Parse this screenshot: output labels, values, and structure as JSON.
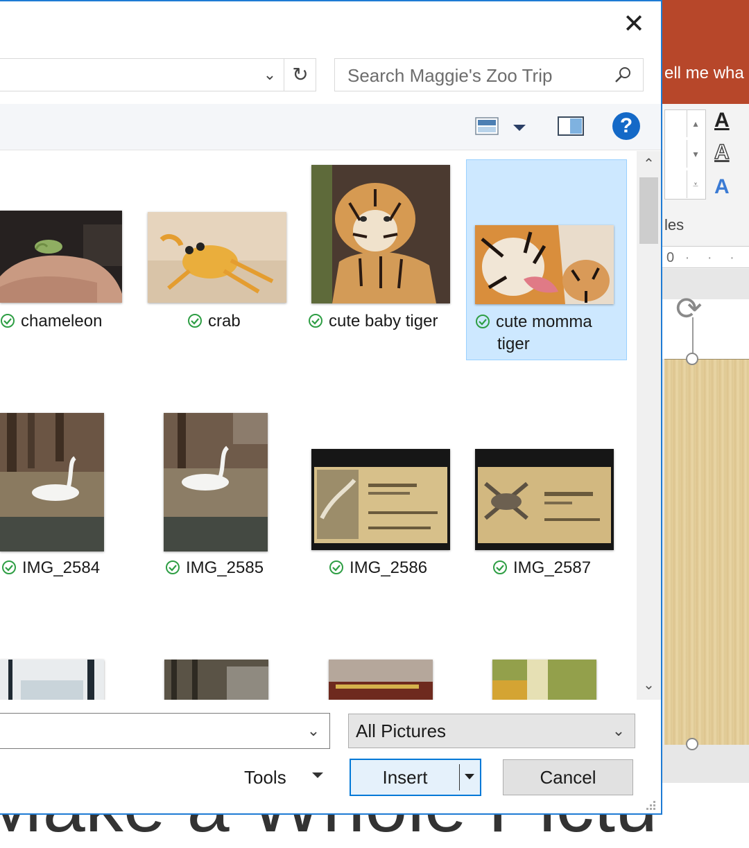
{
  "powerpoint": {
    "tell_me_text": "ell me wha",
    "styles_label": "les",
    "ruler_text": "0",
    "slide_title_text": "Make a Whole Pictu"
  },
  "dialog": {
    "close_glyph": "✕",
    "address": {
      "dropdown_glyph": "⌄",
      "refresh_glyph": "↻"
    },
    "search": {
      "placeholder": "Search Maggie's Zoo Trip"
    },
    "toolbar": {
      "help_glyph": "?"
    },
    "files": [
      {
        "label": "chameleon",
        "sync": "available",
        "selected": false
      },
      {
        "label": "crab",
        "sync": "available",
        "selected": false
      },
      {
        "label": "cute baby tiger",
        "sync": "available",
        "selected": false
      },
      {
        "label_line1": "cute momma",
        "label_line2": "tiger",
        "sync": "available",
        "selected": true
      },
      {
        "label": "IMG_2584",
        "sync": "available",
        "selected": false
      },
      {
        "label": "IMG_2585",
        "sync": "available",
        "selected": false
      },
      {
        "label": "IMG_2586",
        "sync": "available",
        "selected": false
      },
      {
        "label": "IMG_2587",
        "sync": "available",
        "selected": false
      }
    ],
    "scrollbar": {
      "up_glyph": "⌃",
      "down_glyph": "⌄"
    },
    "filename": {
      "value": "",
      "chevron_glyph": "⌄"
    },
    "filetype": {
      "selected": "All Pictures",
      "chevron_glyph": "⌄"
    },
    "buttons": {
      "tools": "Tools",
      "insert": "Insert",
      "cancel": "Cancel"
    },
    "colors": {
      "accent": "#0078d7",
      "selection": "#cde8ff",
      "sync_ok": "#2e9e44",
      "help": "#1469c7"
    }
  }
}
